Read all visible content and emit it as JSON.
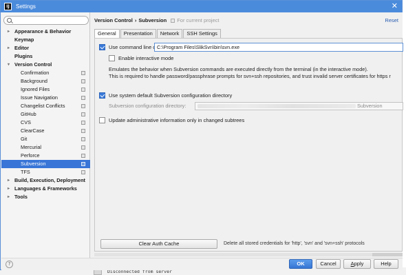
{
  "window": {
    "title": "Settings",
    "app_icon_text": "IJ",
    "close_glyph": "✕"
  },
  "sidebar": {
    "search": {
      "value": "",
      "placeholder": ""
    },
    "items": [
      {
        "label": "Appearance & Behavior",
        "level": "top",
        "arrow": "▸"
      },
      {
        "label": "Keymap",
        "level": "top"
      },
      {
        "label": "Editor",
        "level": "top",
        "arrow": "▸"
      },
      {
        "label": "Plugins",
        "level": "top"
      },
      {
        "label": "Version Control",
        "level": "top",
        "arrow": "▾"
      },
      {
        "label": "Confirmation",
        "level": "child",
        "project_icon": true
      },
      {
        "label": "Background",
        "level": "child",
        "project_icon": true
      },
      {
        "label": "Ignored Files",
        "level": "child",
        "project_icon": true
      },
      {
        "label": "Issue Navigation",
        "level": "child",
        "project_icon": true
      },
      {
        "label": "Changelist Conflicts",
        "level": "child",
        "project_icon": true
      },
      {
        "label": "GitHub",
        "level": "child",
        "project_icon": true
      },
      {
        "label": "CVS",
        "level": "child",
        "project_icon": true
      },
      {
        "label": "ClearCase",
        "level": "child",
        "project_icon": true
      },
      {
        "label": "Git",
        "level": "child",
        "project_icon": true
      },
      {
        "label": "Mercurial",
        "level": "child",
        "project_icon": true
      },
      {
        "label": "Perforce",
        "level": "child",
        "project_icon": true
      },
      {
        "label": "Subversion",
        "level": "child",
        "project_icon": true,
        "selected": true
      },
      {
        "label": "TFS",
        "level": "child",
        "project_icon": true
      },
      {
        "label": "Build, Execution, Deployment",
        "level": "top",
        "arrow": "▸"
      },
      {
        "label": "Languages & Frameworks",
        "level": "top",
        "arrow": "▸"
      },
      {
        "label": "Tools",
        "level": "top",
        "arrow": "▸"
      }
    ]
  },
  "header": {
    "crumb_parent": "Version Control",
    "crumb_sep": "›",
    "crumb_current": "Subversion",
    "project_note": "For current project",
    "reset_label": "Reset"
  },
  "tabs": [
    {
      "label": "General",
      "active": true
    },
    {
      "label": "Presentation"
    },
    {
      "label": "Network"
    },
    {
      "label": "SSH Settings"
    }
  ],
  "general": {
    "use_cmd_client_label": "Use command line client:",
    "use_cmd_client_checked": true,
    "cmd_client_path": "C:\\Program Files\\SlikSvn\\bin\\svn.exe",
    "interactive_label": "Enable interactive mode",
    "interactive_checked": false,
    "interactive_note_1": "Emulates the behavior when Subversion commands are executed directly from the terminal (in the interactive mode).",
    "interactive_note_2": "This is required to handle password/passphrase prompts for svn+ssh repositories, and trust invalid server certificates for https r",
    "use_system_dir_label": "Use system default Subversion configuration directory",
    "use_system_dir_checked": true,
    "config_dir_label": "Subversion configuration directory:",
    "config_dir_value_tail": "Subversion",
    "update_admin_label": "Update administrative information only in changed subtrees",
    "update_admin_checked": false,
    "clear_cache_label": "Clear Auth Cache",
    "clear_cache_desc": "Delete all stored credentials for 'http', 'svn' and 'svn+ssh' protocols"
  },
  "footer": {
    "help_glyph": "?",
    "ok_label": "OK",
    "cancel_label": "Cancel",
    "apply_label": "Apply",
    "help_label": "Help"
  },
  "background": {
    "console_text": "Disconnected from server"
  },
  "colors": {
    "titlebar": "#4b8bdc",
    "selection": "#3875d7",
    "checkbox": "#3b7ad8",
    "link": "#2a5db0"
  }
}
